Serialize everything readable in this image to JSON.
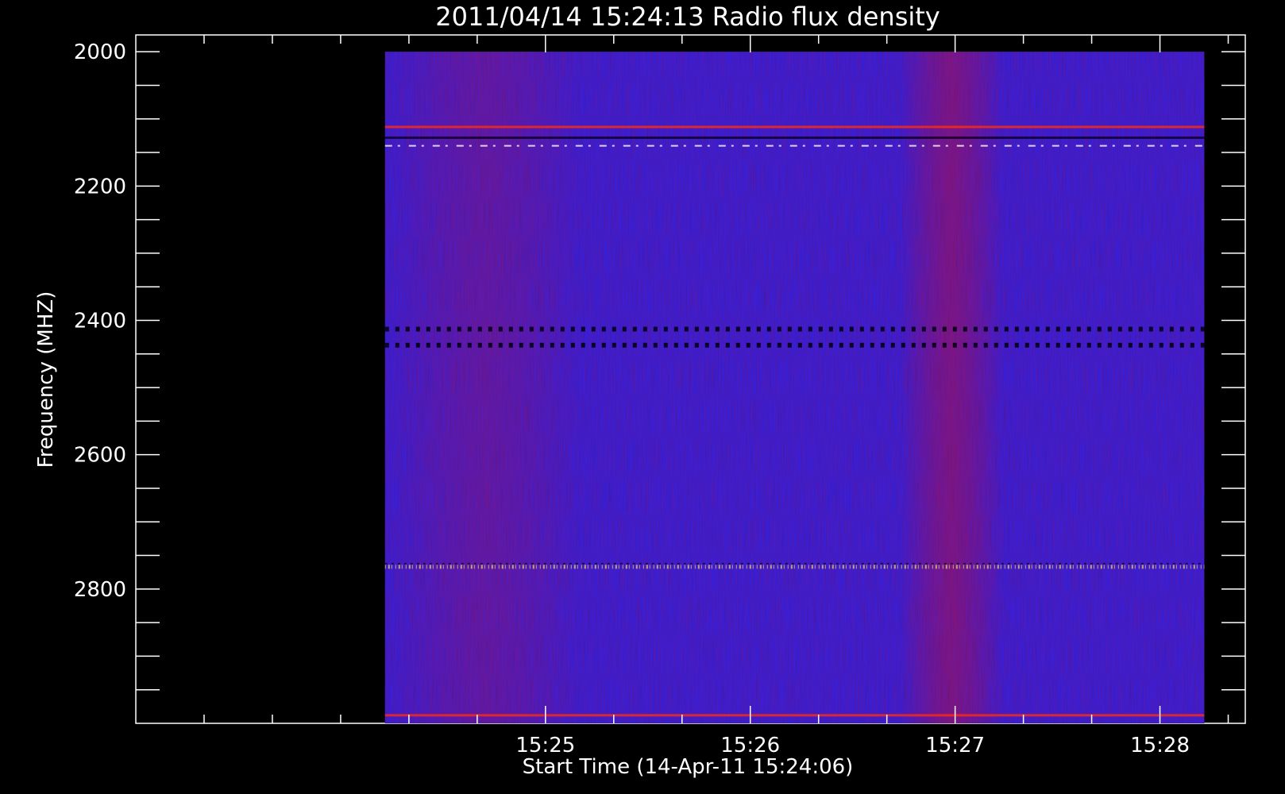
{
  "chart_data": {
    "type": "heatmap",
    "title": "2011/04/14 15:24:13 Radio flux density",
    "xlabel": "Start Time (14-Apr-11 15:24:06)",
    "ylabel": "Frequency (MHZ)",
    "x_start": "15:24:13",
    "x_end": "15:28:13",
    "xlim": [
      "15:23:00",
      "15:28:25"
    ],
    "x_ticks": [
      {
        "t": "15:23:20"
      },
      {
        "t": "15:23:40"
      },
      {
        "t": "15:24:00"
      },
      {
        "t": "15:24:20"
      },
      {
        "t": "15:24:40"
      },
      {
        "t": "15:25:00",
        "label": "15:25"
      },
      {
        "t": "15:25:20"
      },
      {
        "t": "15:25:40"
      },
      {
        "t": "15:26:00",
        "label": "15:26"
      },
      {
        "t": "15:26:20"
      },
      {
        "t": "15:26:40"
      },
      {
        "t": "15:27:00",
        "label": "15:27"
      },
      {
        "t": "15:27:20"
      },
      {
        "t": "15:27:40"
      },
      {
        "t": "15:28:00",
        "label": "15:28"
      },
      {
        "t": "15:28:20"
      }
    ],
    "y_axis": "reversed",
    "ylim": [
      1975,
      3000
    ],
    "y_ticks": [
      {
        "v": 2000,
        "label": "2000"
      },
      {
        "v": 2050
      },
      {
        "v": 2100
      },
      {
        "v": 2150
      },
      {
        "v": 2200,
        "label": "2200"
      },
      {
        "v": 2250
      },
      {
        "v": 2300
      },
      {
        "v": 2350
      },
      {
        "v": 2400,
        "label": "2400"
      },
      {
        "v": 2450
      },
      {
        "v": 2500
      },
      {
        "v": 2550
      },
      {
        "v": 2600,
        "label": "2600"
      },
      {
        "v": 2650
      },
      {
        "v": 2700
      },
      {
        "v": 2750
      },
      {
        "v": 2800,
        "label": "2800"
      },
      {
        "v": 2850
      },
      {
        "v": 2900
      },
      {
        "v": 2950
      }
    ],
    "freq_range": [
      2000,
      3000
    ],
    "background_color": "#2a22ee",
    "colors": {
      "low": "#000010",
      "mid": "#2a22ee",
      "high": "#ff2a10",
      "peak": "#ffffff"
    },
    "bands": [
      {
        "freq": 2112,
        "kind": "red-line"
      },
      {
        "freq": 2128,
        "kind": "dark-line"
      },
      {
        "freq": 2140,
        "kind": "bright-dashes"
      },
      {
        "freq": 2413,
        "kind": "black-dashes"
      },
      {
        "freq": 2437,
        "kind": "black-dashes"
      },
      {
        "freq": 2767,
        "kind": "speckle"
      },
      {
        "freq": 2988,
        "kind": "red-line"
      }
    ]
  }
}
